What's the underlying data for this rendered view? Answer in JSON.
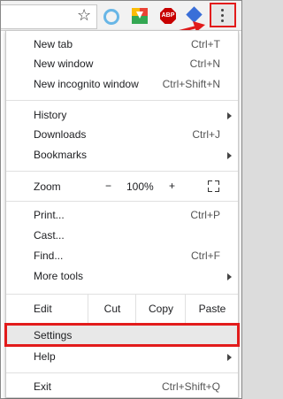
{
  "extensions": {
    "abp_label": "ABP"
  },
  "zoom": {
    "label": "Zoom",
    "minus": "−",
    "value": "100%",
    "plus": "+"
  },
  "edit": {
    "label": "Edit",
    "cut": "Cut",
    "copy": "Copy",
    "paste": "Paste"
  },
  "menu": {
    "new_tab": {
      "label": "New tab",
      "shortcut": "Ctrl+T"
    },
    "new_window": {
      "label": "New window",
      "shortcut": "Ctrl+N"
    },
    "new_incognito": {
      "label": "New incognito window",
      "shortcut": "Ctrl+Shift+N"
    },
    "history": {
      "label": "History"
    },
    "downloads": {
      "label": "Downloads",
      "shortcut": "Ctrl+J"
    },
    "bookmarks": {
      "label": "Bookmarks"
    },
    "print": {
      "label": "Print...",
      "shortcut": "Ctrl+P"
    },
    "cast": {
      "label": "Cast..."
    },
    "find": {
      "label": "Find...",
      "shortcut": "Ctrl+F"
    },
    "more_tools": {
      "label": "More tools"
    },
    "settings": {
      "label": "Settings"
    },
    "help": {
      "label": "Help"
    },
    "exit": {
      "label": "Exit",
      "shortcut": "Ctrl+Shift+Q"
    }
  }
}
